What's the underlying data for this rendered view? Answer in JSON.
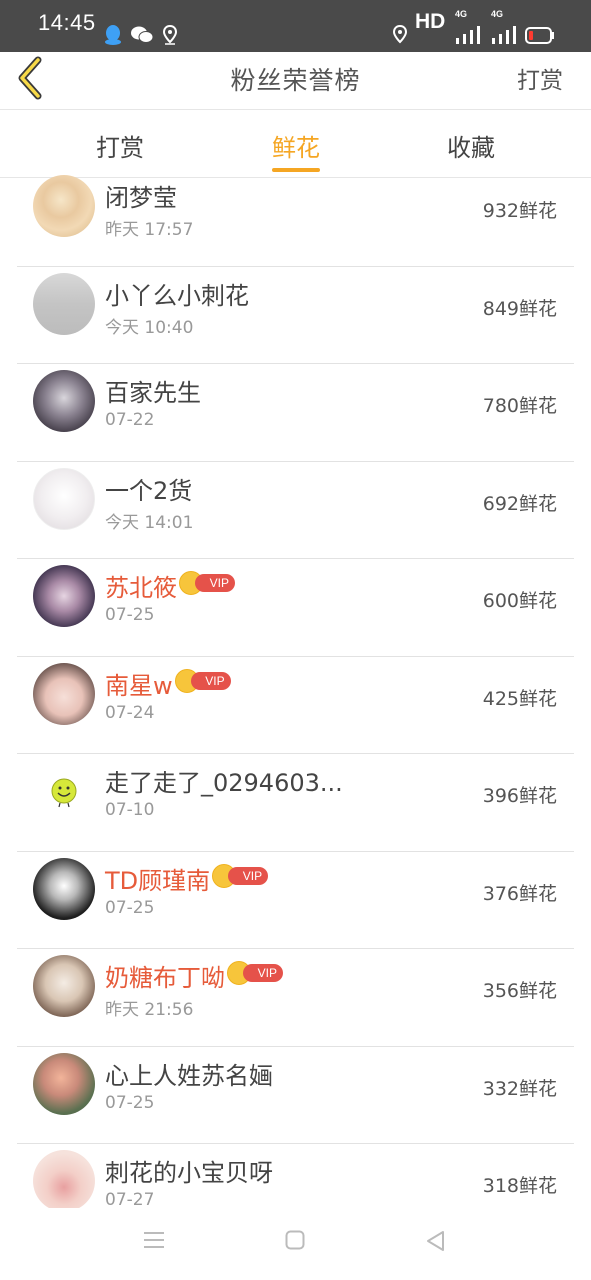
{
  "status_bar": {
    "time": "14:45",
    "hd_label": "HD",
    "net1": "4G",
    "net2": "4G"
  },
  "nav": {
    "title": "粉丝荣誉榜",
    "action": "打赏",
    "back_icon": "chevron-left-icon"
  },
  "tabs": [
    {
      "label": "打赏",
      "active": false
    },
    {
      "label": "鲜花",
      "active": true
    },
    {
      "label": "收藏",
      "active": false
    }
  ],
  "accent_color": "#f5a623",
  "vip_name_color": "#e65b3a",
  "fans": [
    {
      "name": "闭梦莹",
      "date": "昨天 17:57",
      "count": "932鲜花",
      "vip": false
    },
    {
      "name": "小丫么小刺花",
      "date": "今天 10:40",
      "count": "849鲜花",
      "vip": false
    },
    {
      "name": "百家先生",
      "date": "07-22",
      "count": "780鲜花",
      "vip": false
    },
    {
      "name": "一个2货",
      "date": "今天 14:01",
      "count": "692鲜花",
      "vip": false
    },
    {
      "name": "苏北筱",
      "date": "07-25",
      "count": "600鲜花",
      "vip": true
    },
    {
      "name": "南星w",
      "date": "07-24",
      "count": "425鲜花",
      "vip": true
    },
    {
      "name": "走了走了_0294603...",
      "date": "07-10",
      "count": "396鲜花",
      "vip": false
    },
    {
      "name": "TD顾瑾南",
      "date": "07-25",
      "count": "376鲜花",
      "vip": true
    },
    {
      "name": "奶糖布丁呦",
      "date": "昨天 21:56",
      "count": "356鲜花",
      "vip": true
    },
    {
      "name": "心上人姓苏名婳",
      "date": "07-25",
      "count": "332鲜花",
      "vip": false
    },
    {
      "name": "刺花的小宝贝呀",
      "date": "07-27",
      "count": "318鲜花",
      "vip": false
    }
  ],
  "vip_label": "VIP"
}
